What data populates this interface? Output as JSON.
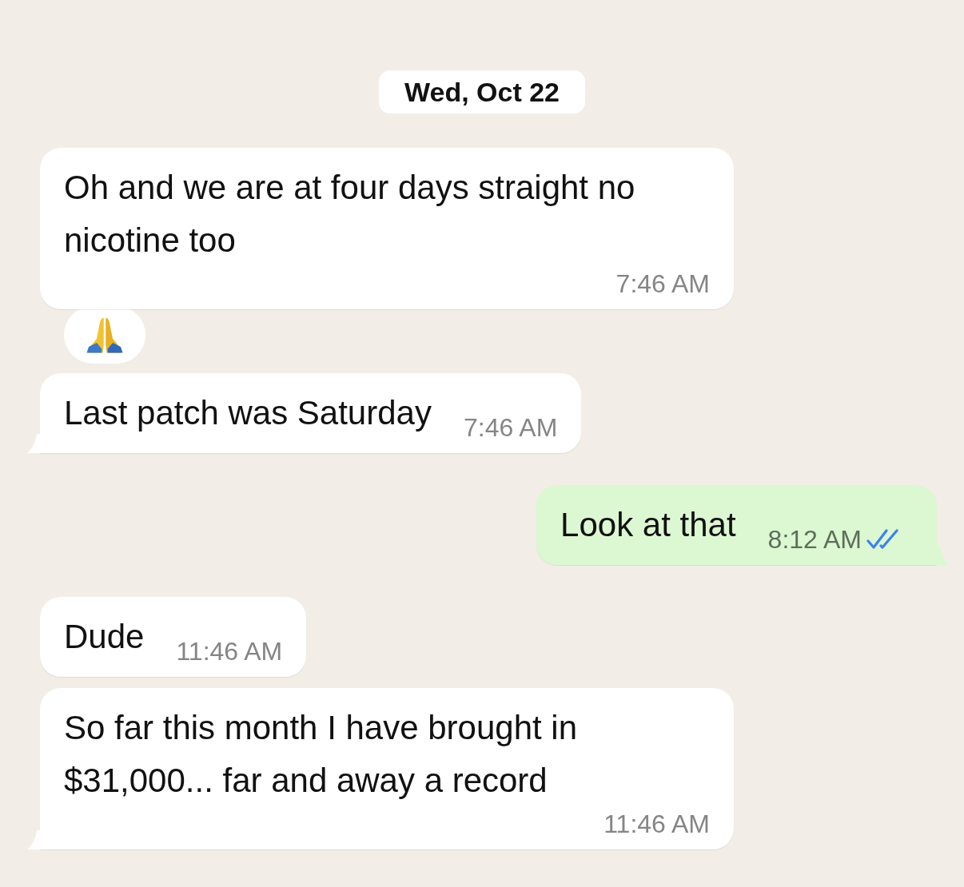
{
  "date_label": "Wed, Oct 22",
  "messages": [
    {
      "kind": "incoming",
      "text": "Oh and we are at four days straight no nicotine too",
      "time": "7:46 AM",
      "tail": false,
      "reaction": true
    },
    {
      "kind": "incoming",
      "text": "Last patch was Saturday",
      "time": "7:46 AM",
      "tail": true,
      "reaction": false
    },
    {
      "kind": "outgoing",
      "text": "Look at that",
      "time": "8:12 AM",
      "tail": true,
      "reaction": false,
      "read": true
    },
    {
      "kind": "incoming",
      "text": "Dude",
      "time": "11:46 AM",
      "tail": false,
      "reaction": false
    },
    {
      "kind": "incoming",
      "text": "So far this month I have brought in $31,000... far and away a record",
      "time": "11:46 AM",
      "tail": true,
      "reaction": false
    }
  ]
}
